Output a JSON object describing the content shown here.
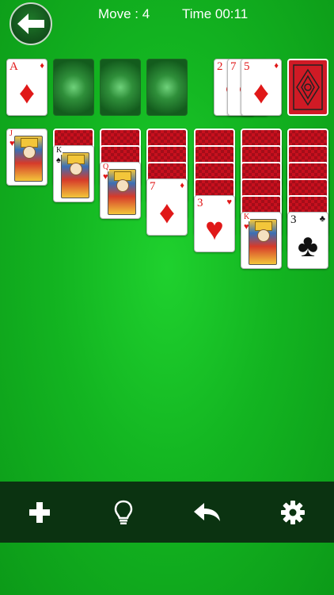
{
  "header": {
    "move_text": "Move : 4",
    "time_text": "Time 00:11"
  },
  "icons": {
    "back": "arrow-left-icon",
    "new_game": "plus-icon",
    "hint": "lightbulb-icon",
    "undo": "undo-icon",
    "settings": "gear-icon"
  },
  "foundations": [
    {
      "rank": "A",
      "suit": "♦",
      "color": "red"
    },
    {
      "empty": true
    },
    {
      "empty": true
    },
    {
      "empty": true
    }
  ],
  "waste": [
    {
      "rank": "2",
      "suit": "♥",
      "color": "red"
    },
    {
      "rank": "7",
      "suit": "♥",
      "color": "red"
    },
    {
      "rank": "5",
      "suit": "♦",
      "color": "red"
    }
  ],
  "tableau": [
    {
      "hidden": 0,
      "top": {
        "rank": "J",
        "suit": "♥",
        "color": "red",
        "court": true
      }
    },
    {
      "hidden": 1,
      "top": {
        "rank": "K",
        "suit": "♠",
        "color": "black",
        "court": true
      }
    },
    {
      "hidden": 2,
      "top": {
        "rank": "Q",
        "suit": "♥",
        "color": "red",
        "court": true
      }
    },
    {
      "hidden": 3,
      "top": {
        "rank": "7",
        "suit": "♦",
        "color": "red"
      }
    },
    {
      "hidden": 4,
      "top": {
        "rank": "3",
        "suit": "♥",
        "color": "red"
      }
    },
    {
      "hidden": 5,
      "top": {
        "rank": "K",
        "suit": "♥",
        "color": "red",
        "court": true
      }
    },
    {
      "hidden": 5,
      "top": {
        "rank": "3",
        "suit": "♣",
        "color": "black"
      }
    }
  ],
  "colors": {
    "table_green": "#13b521",
    "card_back_red": "#c8101e",
    "bottom_bar": "#0b3311"
  }
}
